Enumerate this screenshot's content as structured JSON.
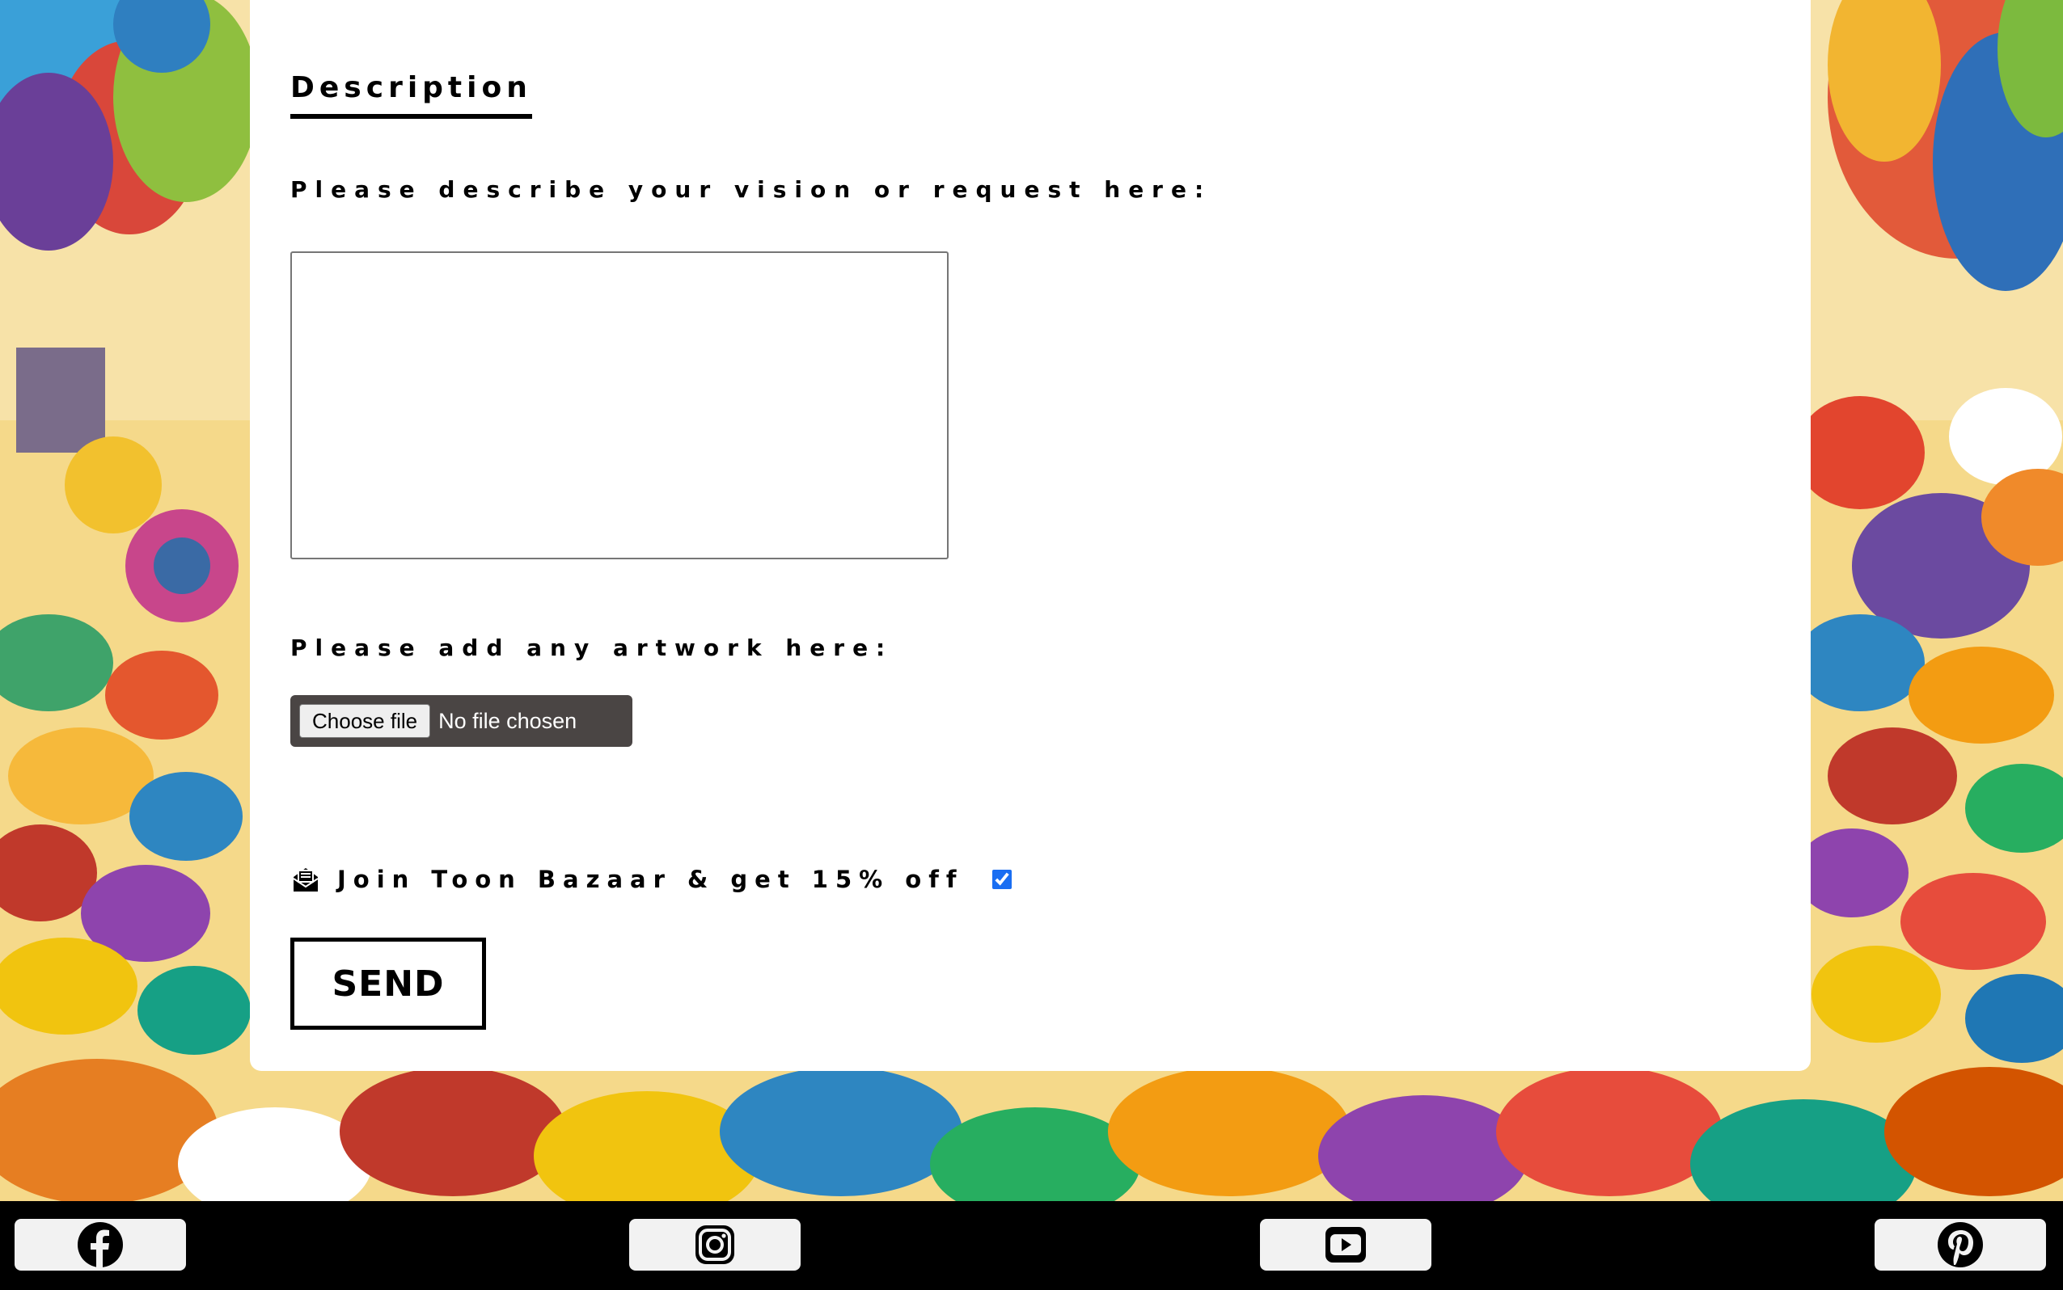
{
  "description_section": {
    "title": "Description",
    "vision_label": "Please describe your vision or request here:",
    "vision_value": "",
    "artwork_label": "Please add any artwork here:",
    "file_button_label": "Choose file",
    "file_status": "No file chosen"
  },
  "newsletter": {
    "icon": "envelope-open-icon",
    "label": "Join Toon Bazaar & get 15% off",
    "checked": true
  },
  "send_button_label": "SEND",
  "footer": {
    "social_links": [
      {
        "name": "Facebook",
        "icon": "facebook-icon"
      },
      {
        "name": "Instagram",
        "icon": "instagram-icon"
      },
      {
        "name": "YouTube",
        "icon": "youtube-icon"
      },
      {
        "name": "Pinterest",
        "icon": "pinterest-icon"
      }
    ]
  },
  "colors": {
    "card_background": "#ffffff",
    "text": "#000000",
    "file_picker_background": "#4a4544",
    "checkbox_accent": "#1a6ef2",
    "footer_background": "#000000",
    "social_button_background": "#f2f2f2"
  }
}
